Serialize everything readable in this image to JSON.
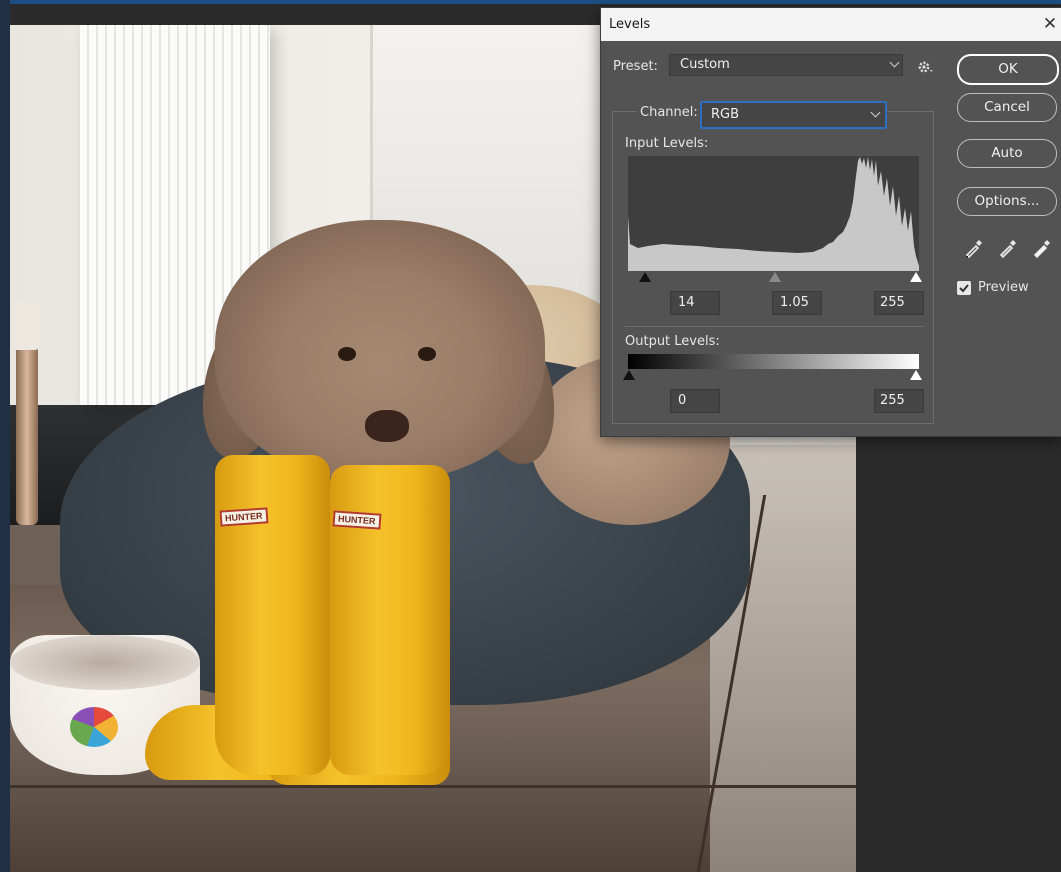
{
  "dialog": {
    "title": "Levels",
    "close_glyph": "✕",
    "preset": {
      "label": "Preset:",
      "value": "Custom"
    },
    "channel": {
      "label": "Channel:",
      "value": "RGB"
    },
    "input_levels": {
      "label": "Input Levels:",
      "black": "14",
      "gamma": "1.05",
      "white": "255"
    },
    "output_levels": {
      "label": "Output Levels:",
      "black": "0",
      "white": "255"
    },
    "buttons": {
      "ok": "OK",
      "cancel": "Cancel",
      "auto": "Auto",
      "options": "Options..."
    },
    "preview": {
      "label": "Preview",
      "checked": true
    },
    "icons": {
      "preset_settings": "gear-icon",
      "eyedroppers": [
        "black-eyedropper-icon",
        "gray-eyedropper-icon",
        "white-eyedropper-icon"
      ]
    },
    "colors": {
      "accent_focus": "#2f6fbf",
      "dialog_bg": "#535353"
    }
  },
  "canvas": {
    "boot_labels": [
      "HUNTER",
      "HUNTER"
    ]
  }
}
